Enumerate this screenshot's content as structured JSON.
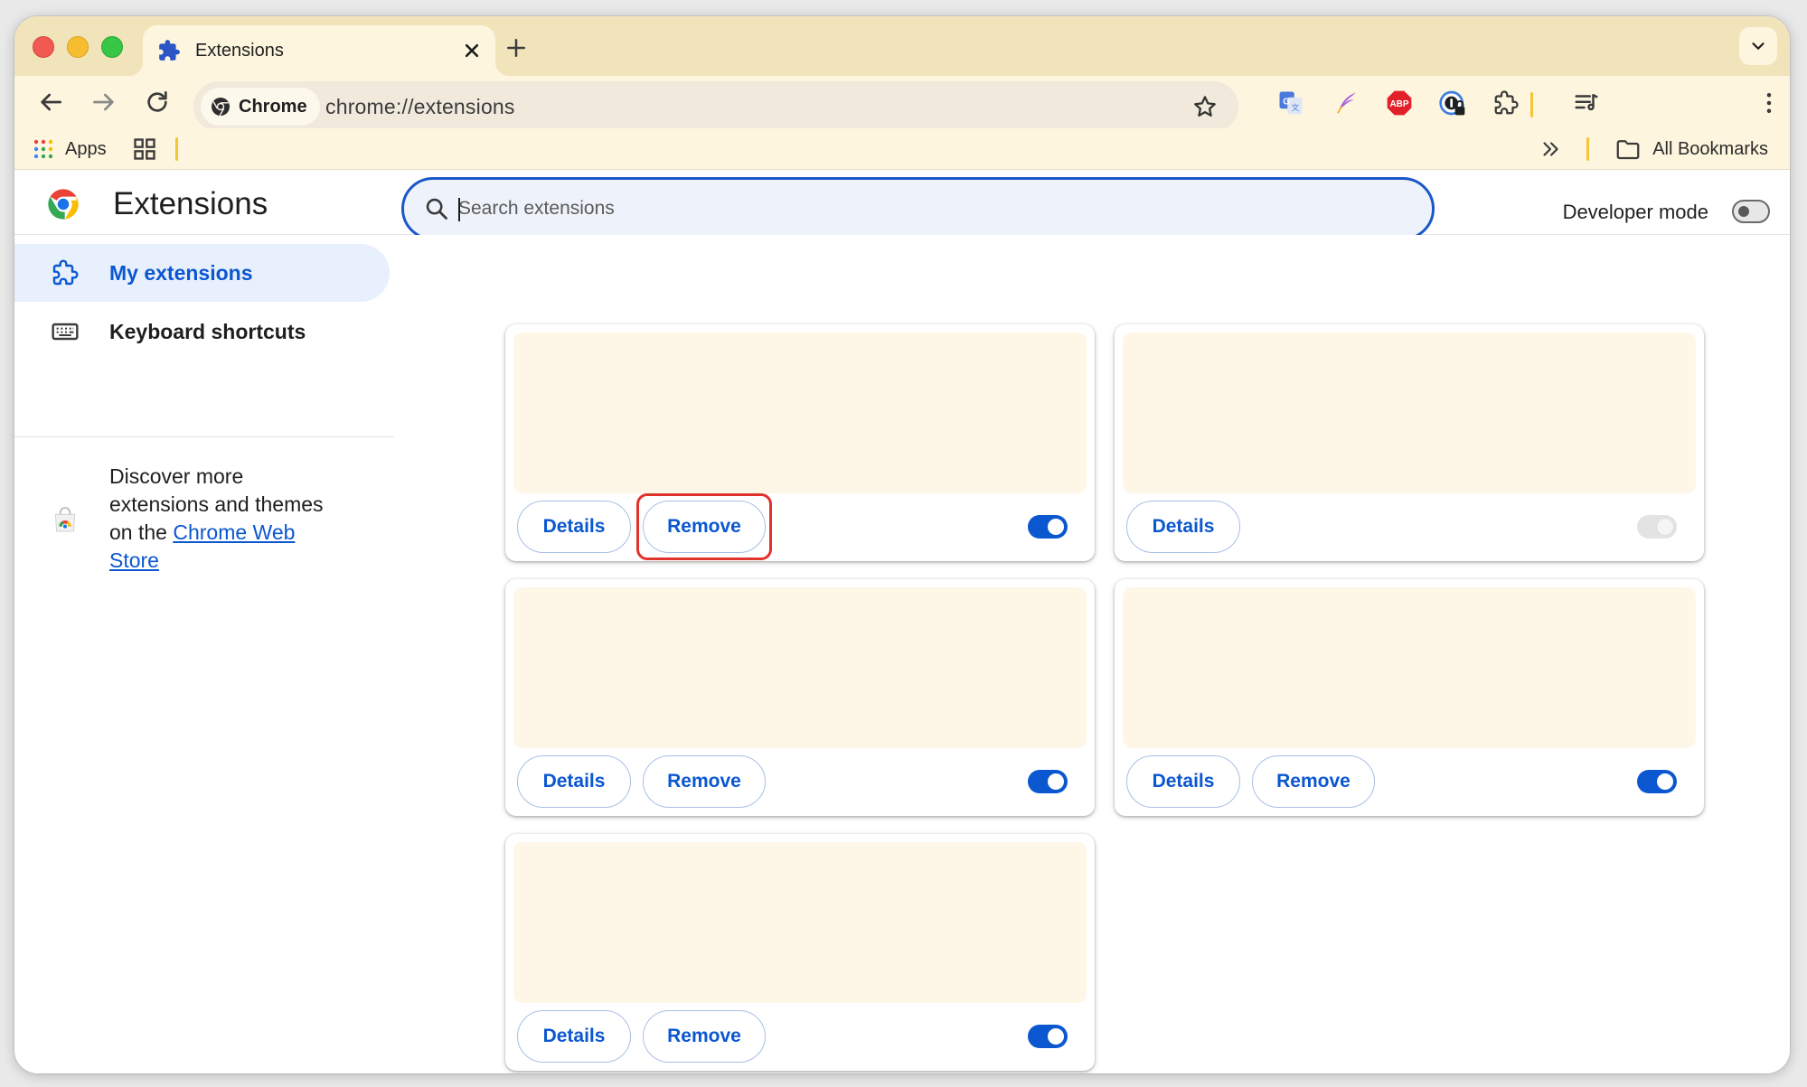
{
  "tab": {
    "title": "Extensions",
    "favicon": "puzzle-piece-icon"
  },
  "toolbar": {
    "chip_label": "Chrome",
    "url": "chrome://extensions",
    "extension_icons": [
      "google-translate-icon",
      "quill-pen-icon",
      "adblock-plus-icon",
      "password-manager-icon",
      "extensions-puzzle-icon",
      "reading-list-icon"
    ]
  },
  "bookmarks": {
    "apps_label": "Apps",
    "all_bookmarks_label": "All Bookmarks"
  },
  "header": {
    "title": "Extensions",
    "search_placeholder": "Search extensions",
    "developer_mode_label": "Developer mode",
    "developer_mode_on": false
  },
  "sidebar": {
    "items": [
      {
        "label": "My extensions",
        "icon": "puzzle-piece-icon",
        "active": true
      },
      {
        "label": "Keyboard shortcuts",
        "icon": "keyboard-icon",
        "active": false
      }
    ],
    "discover_prefix": "Discover more extensions and themes on the ",
    "discover_link": "Chrome Web Store"
  },
  "cards": [
    {
      "details_label": "Details",
      "remove_label": "Remove",
      "enabled": true,
      "highlighted_remove": true
    },
    {
      "details_label": "Details",
      "remove_label": "",
      "enabled": false,
      "highlighted_remove": false
    },
    {
      "details_label": "Details",
      "remove_label": "Remove",
      "enabled": true,
      "highlighted_remove": false
    },
    {
      "details_label": "Details",
      "remove_label": "Remove",
      "enabled": true,
      "highlighted_remove": false
    },
    {
      "details_label": "Details",
      "remove_label": "Remove",
      "enabled": true,
      "highlighted_remove": false
    }
  ],
  "colors": {
    "accent": "#0b57d0",
    "tabstrip": "#f1e3ba",
    "toolbar": "#fdf5de",
    "highlight": "#e0332b"
  }
}
